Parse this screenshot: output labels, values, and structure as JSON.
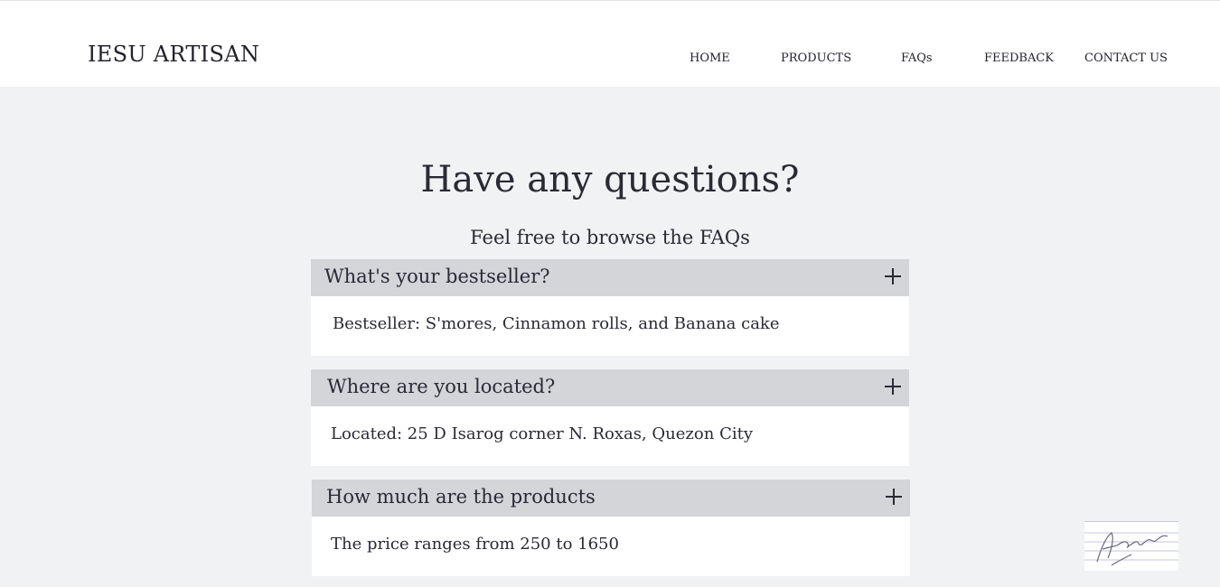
{
  "brand": {
    "name": "IESU ARTISAN"
  },
  "nav": {
    "items": [
      {
        "label": "HOME"
      },
      {
        "label": "PRODUCTS"
      },
      {
        "label": "FAQs"
      },
      {
        "label": "FEEDBACK"
      },
      {
        "label": "CONTACT US"
      }
    ]
  },
  "hero": {
    "title": "Have any questions?",
    "subtitle": "Feel free to browse the FAQs"
  },
  "faqs": [
    {
      "question": "What's your bestseller?",
      "answer": "Bestseller: S'mores, Cinnamon rolls, and Banana cake",
      "icon": "plus-icon"
    },
    {
      "question": "Where are you located?",
      "answer": "Located: 25 D Isarog corner N. Roxas, Quezon City",
      "icon": "plus-icon"
    },
    {
      "question": "How much are the products",
      "answer": "The price ranges from 250 to 1650",
      "icon": "plus-icon"
    }
  ],
  "colors": {
    "page_background": "#f1f2f4",
    "header_background": "#ffffff",
    "question_background": "#d3d5d9",
    "answer_background": "#ffffff",
    "text": "#2a2a35"
  }
}
